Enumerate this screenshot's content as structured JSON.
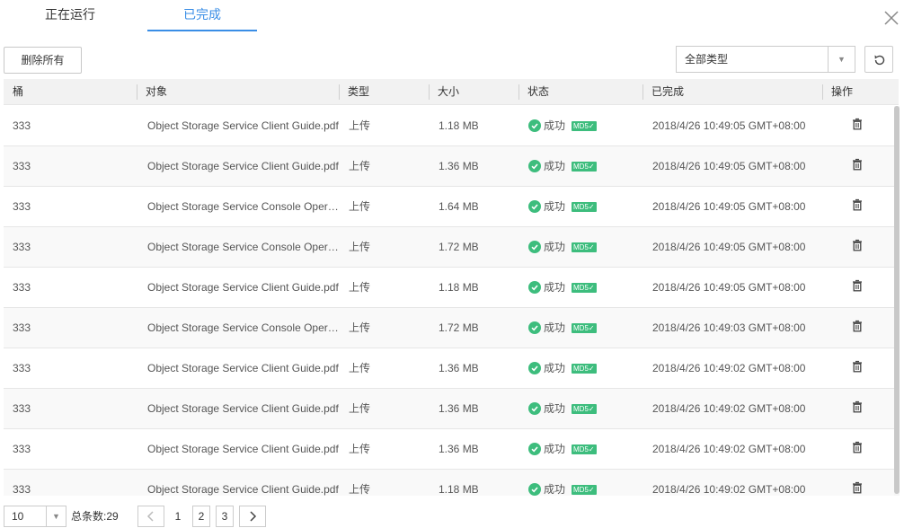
{
  "tabs": [
    {
      "label": "正在运行",
      "active": false
    },
    {
      "label": "已完成",
      "active": true
    }
  ],
  "toolbar": {
    "delete_all_label": "删除所有",
    "type_filter_value": "全部类型"
  },
  "table": {
    "headers": [
      "桶",
      "对象",
      "类型",
      "大小",
      "状态",
      "已完成",
      "操作"
    ],
    "rows": [
      {
        "bucket": "333",
        "object": "Object Storage Service Client Guide.pdf",
        "type": "上传",
        "size": "1.18 MB",
        "status": "成功",
        "md5": "MD5✓",
        "completed": "2018/4/26 10:49:05 GMT+08:00"
      },
      {
        "bucket": "333",
        "object": "Object Storage Service Client Guide.pdf",
        "type": "上传",
        "size": "1.36 MB",
        "status": "成功",
        "md5": "MD5✓",
        "completed": "2018/4/26 10:49:05 GMT+08:00"
      },
      {
        "bucket": "333",
        "object": "Object Storage Service Console Operation Guide.pdf",
        "type": "上传",
        "size": "1.64 MB",
        "status": "成功",
        "md5": "MD5✓",
        "completed": "2018/4/26 10:49:05 GMT+08:00"
      },
      {
        "bucket": "333",
        "object": "Object Storage Service Console Operation Guide.pdf",
        "type": "上传",
        "size": "1.72 MB",
        "status": "成功",
        "md5": "MD5✓",
        "completed": "2018/4/26 10:49:05 GMT+08:00"
      },
      {
        "bucket": "333",
        "object": "Object Storage Service Client Guide.pdf",
        "type": "上传",
        "size": "1.18 MB",
        "status": "成功",
        "md5": "MD5✓",
        "completed": "2018/4/26 10:49:05 GMT+08:00"
      },
      {
        "bucket": "333",
        "object": "Object Storage Service Console Operation Guide.pdf",
        "type": "上传",
        "size": "1.72 MB",
        "status": "成功",
        "md5": "MD5✓",
        "completed": "2018/4/26 10:49:03 GMT+08:00"
      },
      {
        "bucket": "333",
        "object": "Object Storage Service Client Guide.pdf",
        "type": "上传",
        "size": "1.36 MB",
        "status": "成功",
        "md5": "MD5✓",
        "completed": "2018/4/26 10:49:02 GMT+08:00"
      },
      {
        "bucket": "333",
        "object": "Object Storage Service Client Guide.pdf",
        "type": "上传",
        "size": "1.36 MB",
        "status": "成功",
        "md5": "MD5✓",
        "completed": "2018/4/26 10:49:02 GMT+08:00"
      },
      {
        "bucket": "333",
        "object": "Object Storage Service Client Guide.pdf",
        "type": "上传",
        "size": "1.36 MB",
        "status": "成功",
        "md5": "MD5✓",
        "completed": "2018/4/26 10:49:02 GMT+08:00"
      },
      {
        "bucket": "333",
        "object": "Object Storage Service Client Guide.pdf",
        "type": "上传",
        "size": "1.18 MB",
        "status": "成功",
        "md5": "MD5✓",
        "completed": "2018/4/26 10:49:02 GMT+08:00"
      }
    ]
  },
  "pagination": {
    "page_size": "10",
    "total_label": "总条数:29",
    "pages": [
      "1",
      "2",
      "3"
    ],
    "current_page": "1"
  },
  "colors": {
    "accent": "#3a8ee6",
    "success": "#3dbd7d"
  },
  "icons": {
    "close": "close-icon",
    "refresh": "refresh-icon",
    "success": "check-circle-icon",
    "delete": "trash-icon",
    "dropdown": "chevron-down-icon",
    "prev": "chevron-left-icon",
    "next": "chevron-right-icon"
  }
}
